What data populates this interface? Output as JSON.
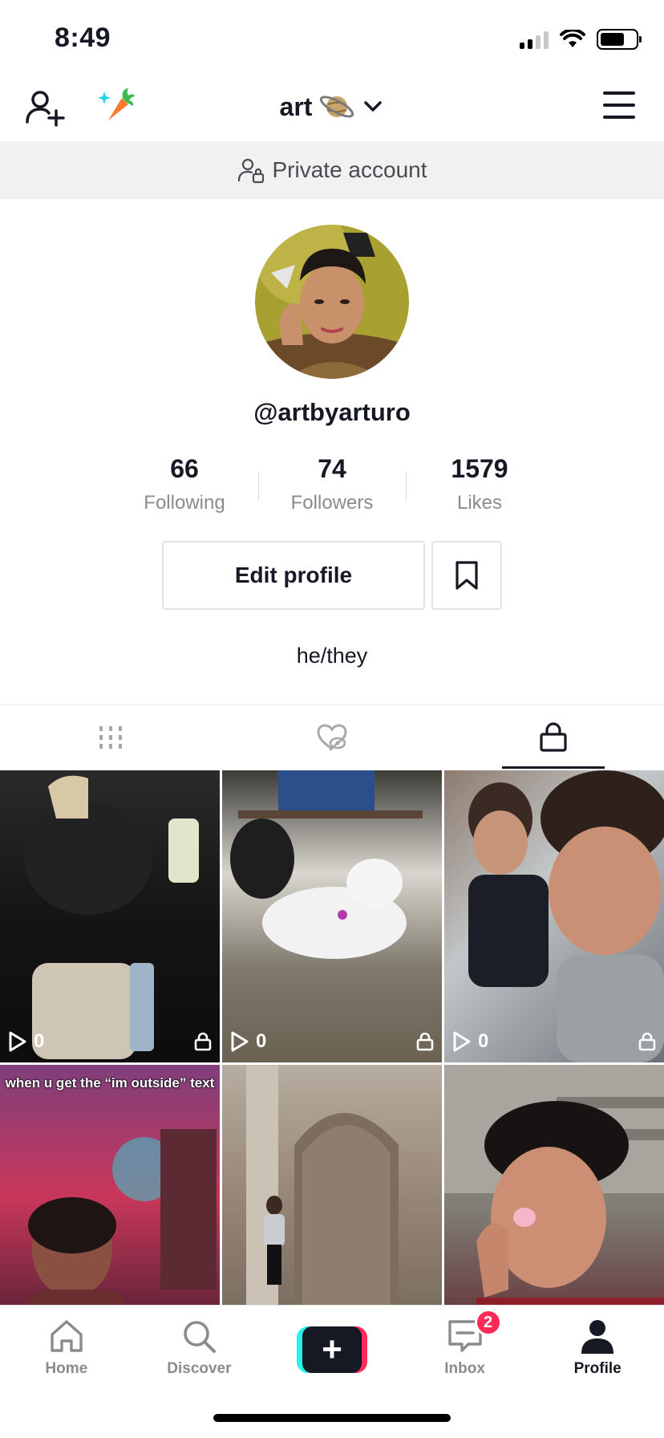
{
  "status_bar": {
    "time": "8:49"
  },
  "header": {
    "title": "art"
  },
  "banner": {
    "text": "Private account"
  },
  "profile": {
    "username": "@artbyarturo",
    "bio": "he/they",
    "stats": [
      {
        "value": "66",
        "label": "Following"
      },
      {
        "value": "74",
        "label": "Followers"
      },
      {
        "value": "1579",
        "label": "Likes"
      }
    ],
    "edit_label": "Edit profile"
  },
  "videos": [
    {
      "views": "0",
      "caption": ""
    },
    {
      "views": "0",
      "caption": ""
    },
    {
      "views": "0",
      "caption": ""
    },
    {
      "caption": "when u get the “im outside” text"
    },
    {
      "caption": ""
    },
    {
      "caption": ""
    }
  ],
  "nav": {
    "home": "Home",
    "discover": "Discover",
    "inbox": "Inbox",
    "inbox_badge": "2",
    "profile": "Profile"
  },
  "colors": {
    "accent_red": "#fe2c55",
    "accent_cyan": "#25f4ee",
    "text": "#161823",
    "muted": "#8a8b91"
  }
}
